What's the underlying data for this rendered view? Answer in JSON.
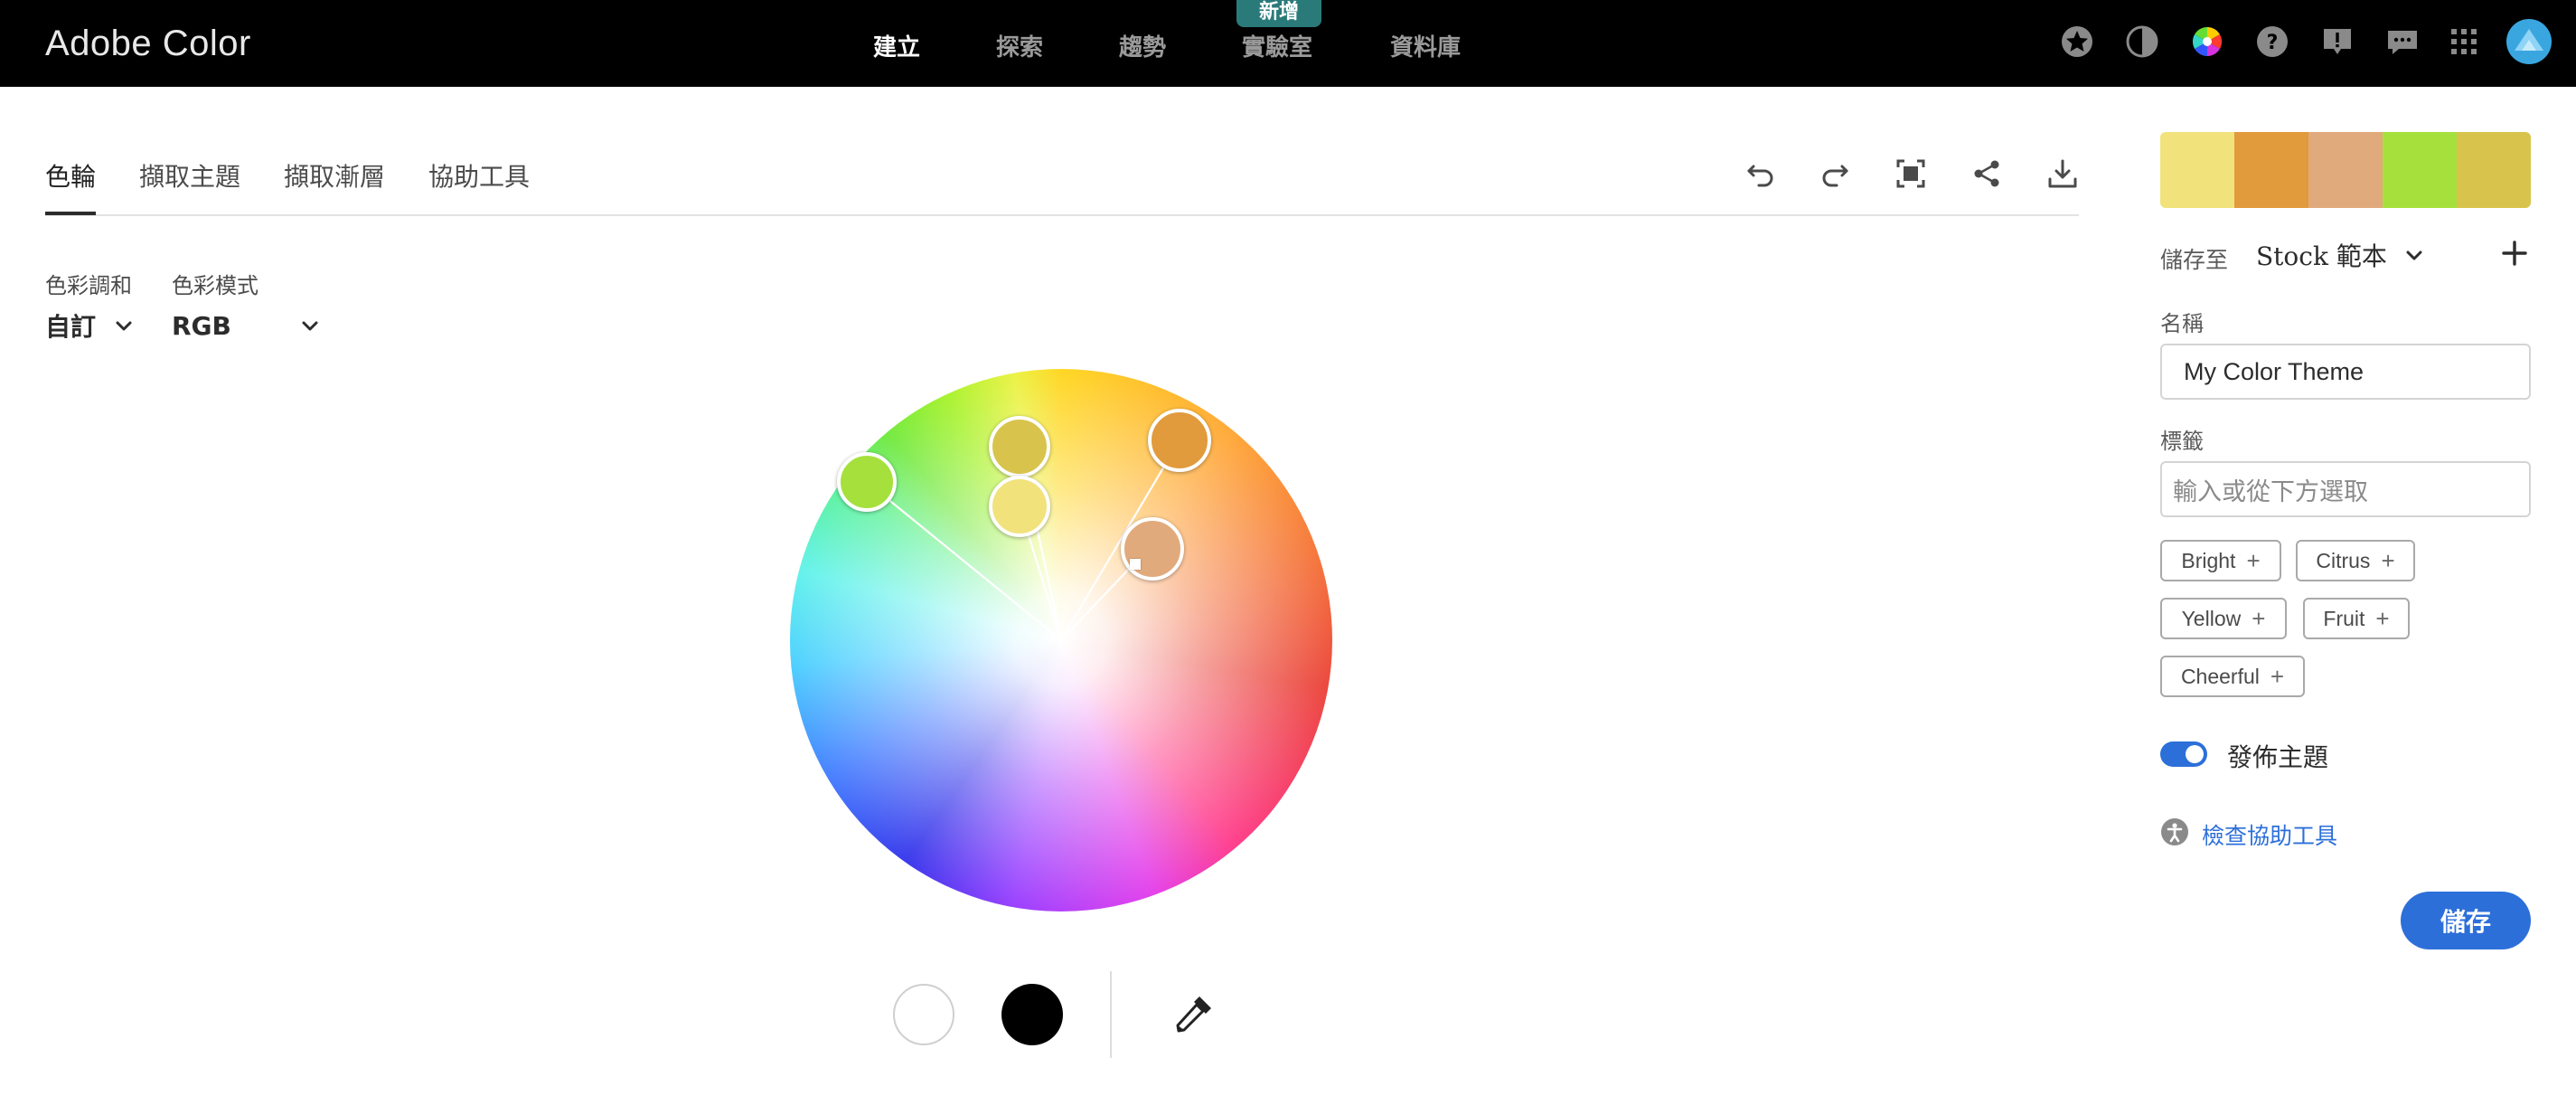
{
  "app": {
    "brand": "Adobe Color"
  },
  "nav": {
    "tabs": [
      {
        "label": "建立"
      },
      {
        "label": "探索"
      },
      {
        "label": "趨勢"
      },
      {
        "label": "實驗室"
      },
      {
        "label": "資料庫"
      }
    ],
    "new_badge": "新增",
    "icons": [
      "star-icon",
      "contrast-icon",
      "color-wheel-icon",
      "help-icon",
      "alert-icon",
      "feedback-icon",
      "apps-grid-icon",
      "avatar"
    ]
  },
  "subtabs": [
    {
      "label": "色輪"
    },
    {
      "label": "擷取主題"
    },
    {
      "label": "擷取漸層"
    },
    {
      "label": "協助工具"
    }
  ],
  "toolbar": {
    "icons": [
      "undo-icon",
      "redo-icon",
      "fullscreen-icon",
      "share-icon",
      "download-icon"
    ]
  },
  "harmony": {
    "label": "色彩調和",
    "value": "自訂"
  },
  "color_mode": {
    "label": "色彩模式",
    "value": "RGB"
  },
  "wheel": {
    "handles": [
      {
        "name": "green",
        "color": "#a6e03c"
      },
      {
        "name": "olive",
        "color": "#d8c44c"
      },
      {
        "name": "yellow",
        "color": "#f1e27c"
      },
      {
        "name": "orange",
        "color": "#e19a3c"
      },
      {
        "name": "tan",
        "color": "#e1aa7c"
      }
    ]
  },
  "palette": {
    "swatches": [
      "#f1e27c",
      "#e19a3c",
      "#e1aa7c",
      "#a6e03c",
      "#d8c44c"
    ]
  },
  "save_to": {
    "label": "儲存至",
    "value": "Stock 範本"
  },
  "name": {
    "label": "名稱",
    "value": "My Color Theme"
  },
  "tags": {
    "label": "標籤",
    "placeholder": "輸入或從下方選取",
    "items": [
      "Bright",
      "Citrus",
      "Yellow",
      "Fruit",
      "Cheerful"
    ]
  },
  "publish": {
    "label": "發佈主題",
    "on": true
  },
  "accessibility_link": "檢查協助工具",
  "save_button": "儲存",
  "colors": {
    "accent": "#2c6fd9",
    "nav_bg": "#000000",
    "badge": "#2b7a7a"
  }
}
